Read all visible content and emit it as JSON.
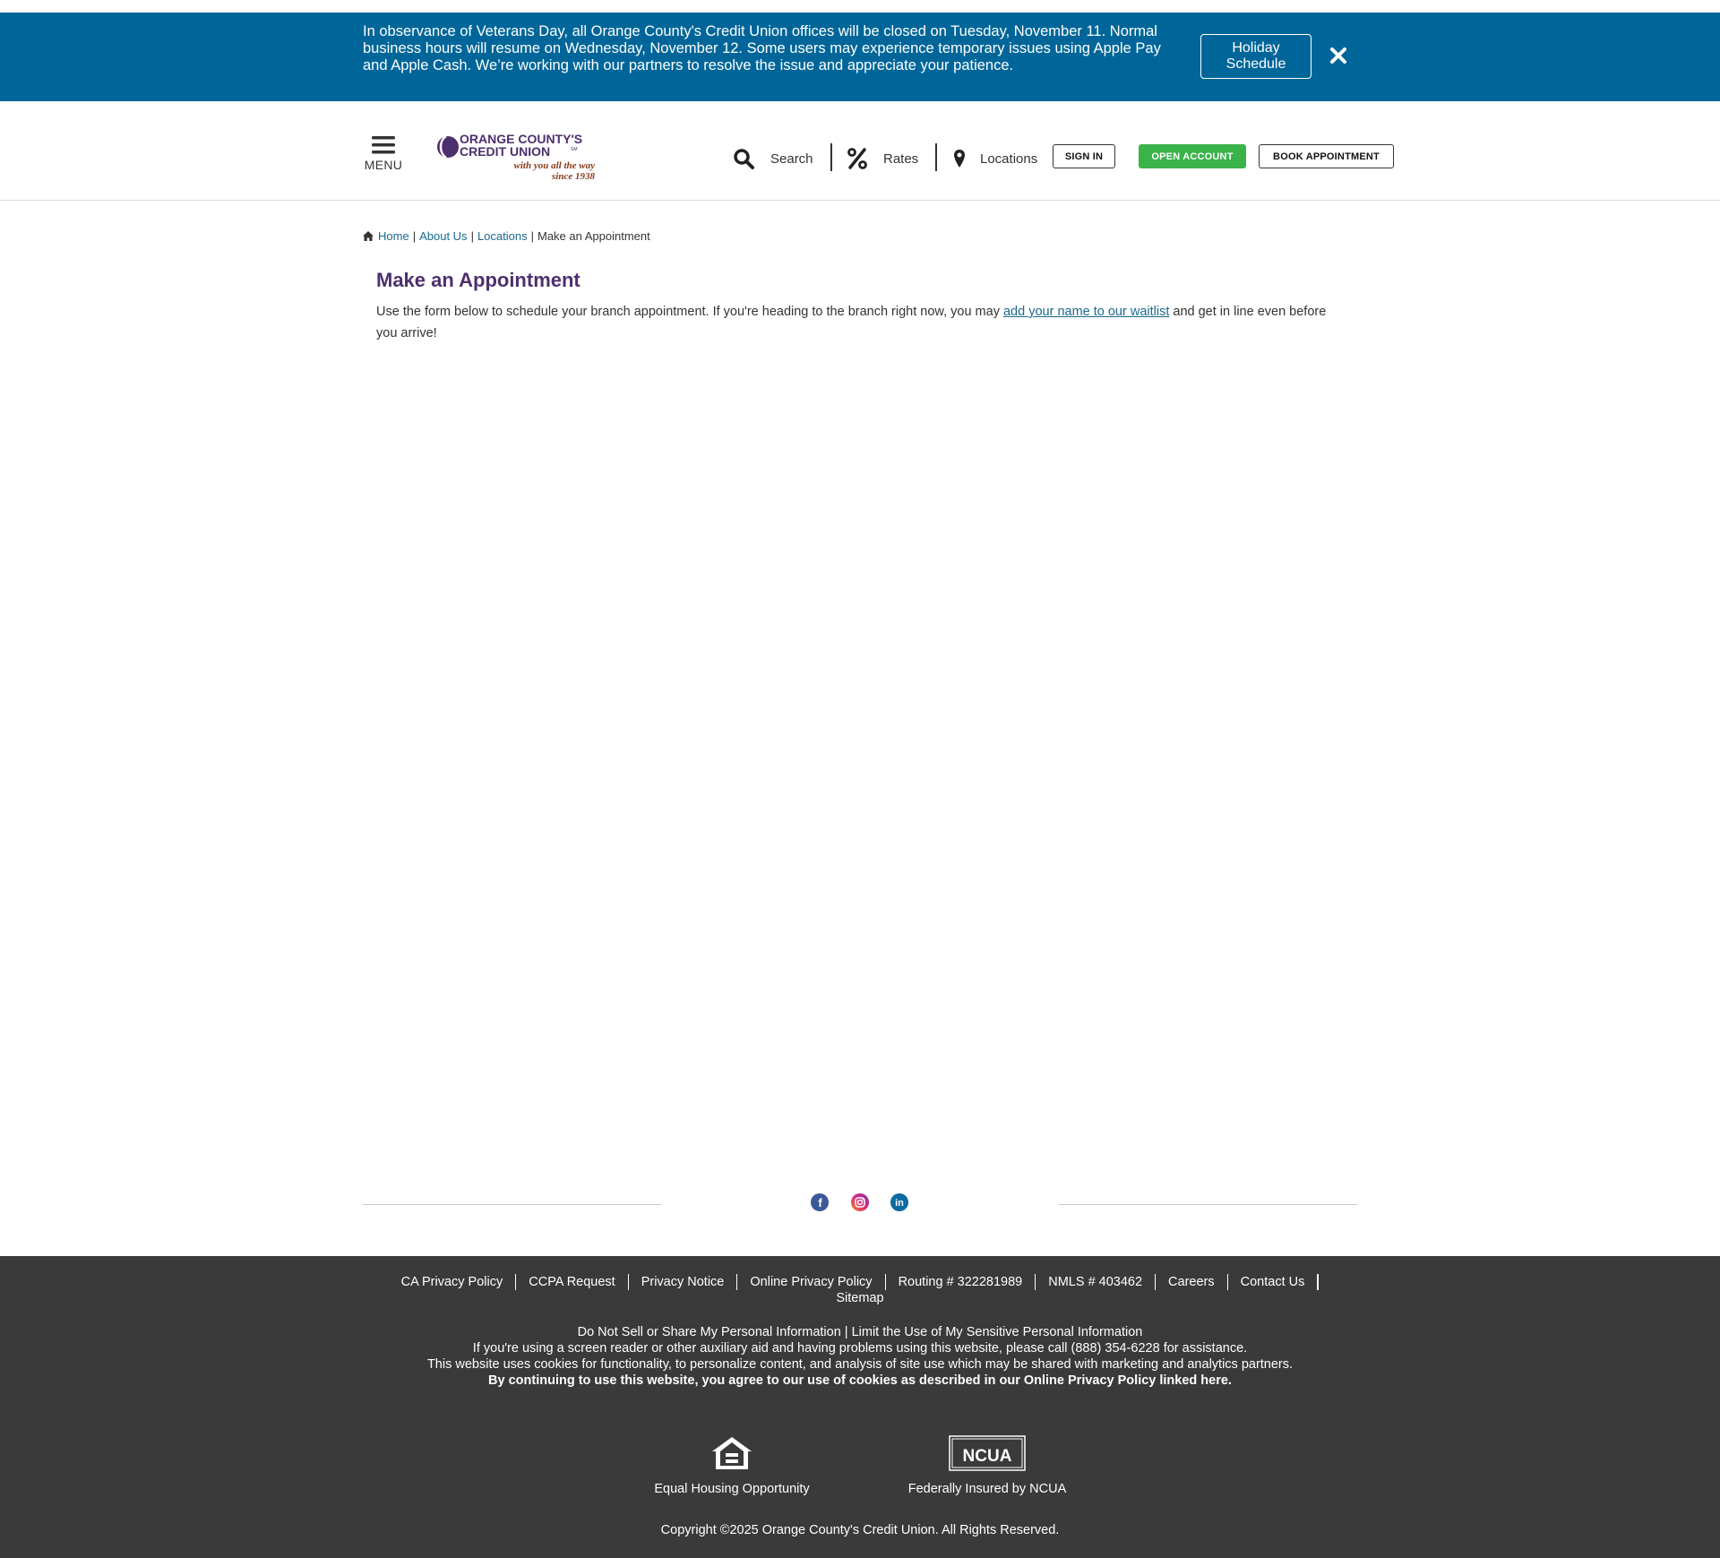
{
  "alert": {
    "message": "In observance of Veterans Day, all Orange County's Credit Union offices will be closed on Tuesday, November 11. Normal business hours will resume on Wednesday, November 12. Some users may experience temporary issues using Apple Pay and Apple Cash. We’re working with our partners to resolve the issue and appreciate your patience.",
    "holiday_button": "Holiday Schedule"
  },
  "header": {
    "menu_label": "MENU",
    "logo_line1": "ORANGE COUNTY'S",
    "logo_line2": "CREDIT UNION",
    "logo_tm": "SM",
    "logo_tagline1": "with you all the way",
    "logo_tagline2": "since 1938",
    "search_label": "Search",
    "rates_label": "Rates",
    "locations_label": "Locations",
    "sign_in": "SIGN IN",
    "open_account": "OPEN ACCOUNT",
    "book_appointment": "BOOK APPOINTMENT"
  },
  "breadcrumb": {
    "home": "Home",
    "about": "About Us",
    "locations": "Locations",
    "current": "Make an Appointment",
    "separator": "|"
  },
  "main": {
    "title": "Make an Appointment",
    "intro_before": "Use the form below to schedule your branch appointment. If you're heading to the branch right now, you may ",
    "intro_link": "add your name to our waitlist",
    "intro_after": " and get in line even before you arrive!"
  },
  "social": {
    "icons": [
      "facebook-icon",
      "instagram-icon",
      "linkedin-icon"
    ],
    "linkedin_letters": "in",
    "facebook_letter": "f"
  },
  "footer": {
    "links": [
      "CA Privacy Policy",
      "CCPA Request",
      "Privacy Notice",
      "Online Privacy Policy",
      "Routing # 322281989",
      "NMLS # 403462",
      "Careers",
      "Contact Us",
      "Sitemap"
    ],
    "do_not_sell": "Do Not Sell or Share My Personal Information",
    "limit_use": "Limit the Use of My Sensitive Personal Information",
    "pipe": " | ",
    "screen_reader_note": "If you're using a screen reader or other auxiliary aid and having problems using this website, please call (888) 354-6228 for assistance.",
    "cookies_note": "This website uses cookies for functionality, to personalize content, and analysis of site use which may be shared with marketing and analytics partners.",
    "cookies_agree": "By continuing to use this website, you agree to our use of cookies as described in our Online Privacy Policy linked here.",
    "equal_housing": "Equal Housing Opportunity",
    "ncua": "Federally Insured by NCUA",
    "ncua_badge": "NCUA",
    "copyright": "Copyright ©2025 Orange County's Credit Union. All Rights Reserved."
  },
  "colors": {
    "alert_bg": "#006699",
    "brand_purple": "#4d2f6e",
    "brand_orange": "#8b3a1a",
    "link": "#1a6a8d",
    "open_account_green": "#3ab34a",
    "footer_bg": "#3a3a3a"
  }
}
